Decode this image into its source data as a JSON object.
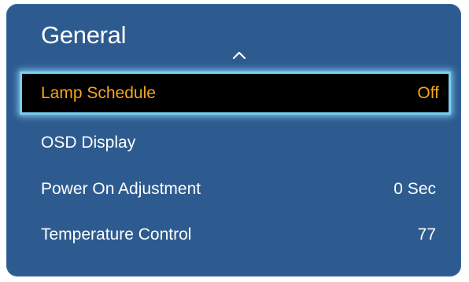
{
  "menu": {
    "title": "General",
    "scroll_indicator_icon": "chevron-up-icon",
    "highlight_color": "#f3a51d",
    "panel_color": "#2e5b8f",
    "items": [
      {
        "label": "Lamp Schedule",
        "value": "Off",
        "selected": true
      },
      {
        "label": "OSD Display",
        "value": "",
        "selected": false
      },
      {
        "label": "Power On Adjustment",
        "value": "0 Sec",
        "selected": false
      },
      {
        "label": "Temperature Control",
        "value": "77",
        "selected": false
      }
    ]
  }
}
